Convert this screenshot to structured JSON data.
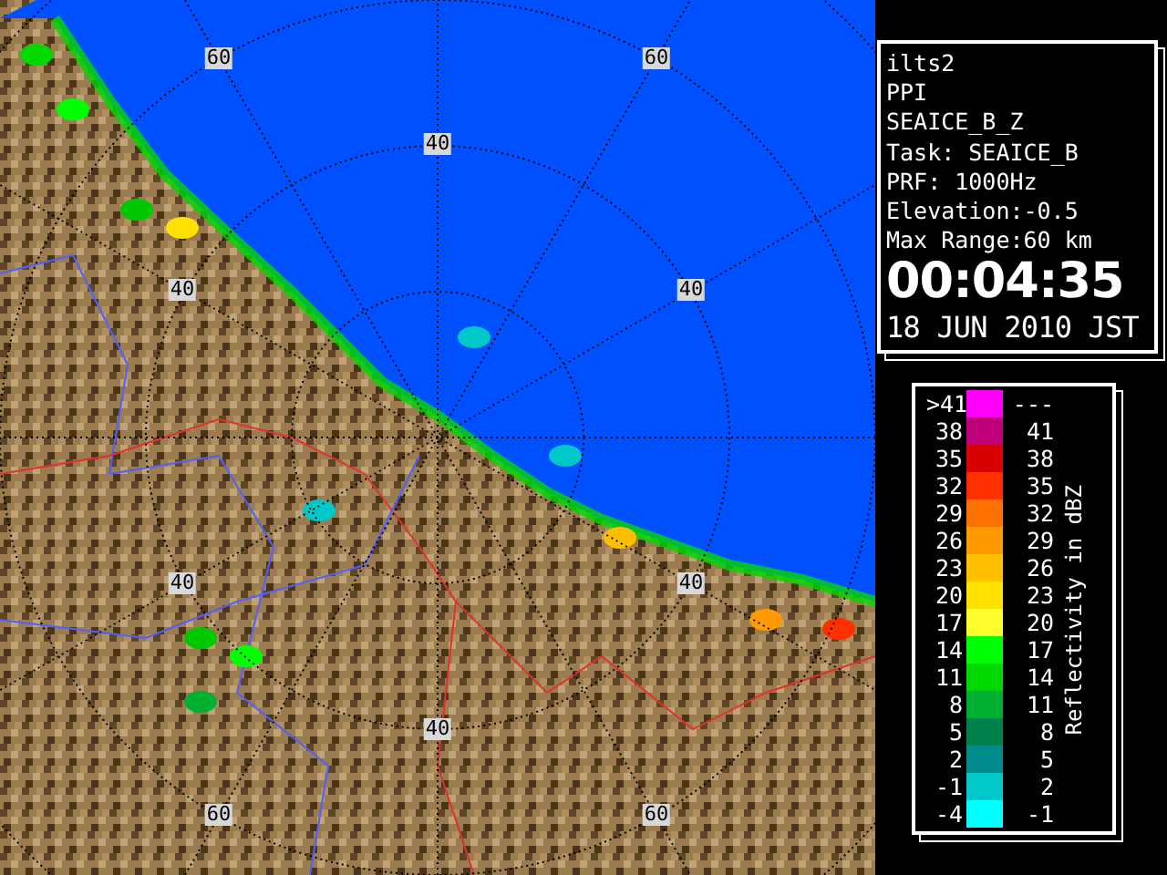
{
  "radar_map": {
    "range_labels": [
      "60",
      "60",
      "40",
      "40",
      "40",
      "40",
      "40",
      "40",
      "60",
      "60"
    ]
  },
  "info_panel": {
    "lines": [
      "ilts2",
      "PPI",
      "SEAICE_B_Z",
      "Task: SEAICE_B",
      "PRF: 1000Hz",
      "Elevation:-0.5",
      "Max Range:60 km"
    ],
    "time": "00:04:35",
    "date": "18 JUN 2010 JST"
  },
  "legend": {
    "title": "Reflectivity in dBZ",
    "rows": [
      {
        "low": ">41",
        "high": "---",
        "color": "#ff00ff"
      },
      {
        "low": "38",
        "high": "41",
        "color": "#c0007a"
      },
      {
        "low": "35",
        "high": "38",
        "color": "#d80000"
      },
      {
        "low": "32",
        "high": "35",
        "color": "#ff3000"
      },
      {
        "low": "29",
        "high": "32",
        "color": "#ff7000"
      },
      {
        "low": "26",
        "high": "29",
        "color": "#ff9a00"
      },
      {
        "low": "23",
        "high": "26",
        "color": "#ffbe00"
      },
      {
        "low": "20",
        "high": "23",
        "color": "#ffe000"
      },
      {
        "low": "17",
        "high": "20",
        "color": "#ffff30"
      },
      {
        "low": "14",
        "high": "17",
        "color": "#00ff00"
      },
      {
        "low": "11",
        "high": "14",
        "color": "#00d800"
      },
      {
        "low": "8",
        "high": "11",
        "color": "#00b030"
      },
      {
        "low": "5",
        "high": "8",
        "color": "#00804a"
      },
      {
        "low": "2",
        "high": "5",
        "color": "#008c8c"
      },
      {
        "low": "-1",
        "high": "2",
        "color": "#00c8c8"
      },
      {
        "low": "-4",
        "high": "-1",
        "color": "#00ffff"
      }
    ]
  }
}
